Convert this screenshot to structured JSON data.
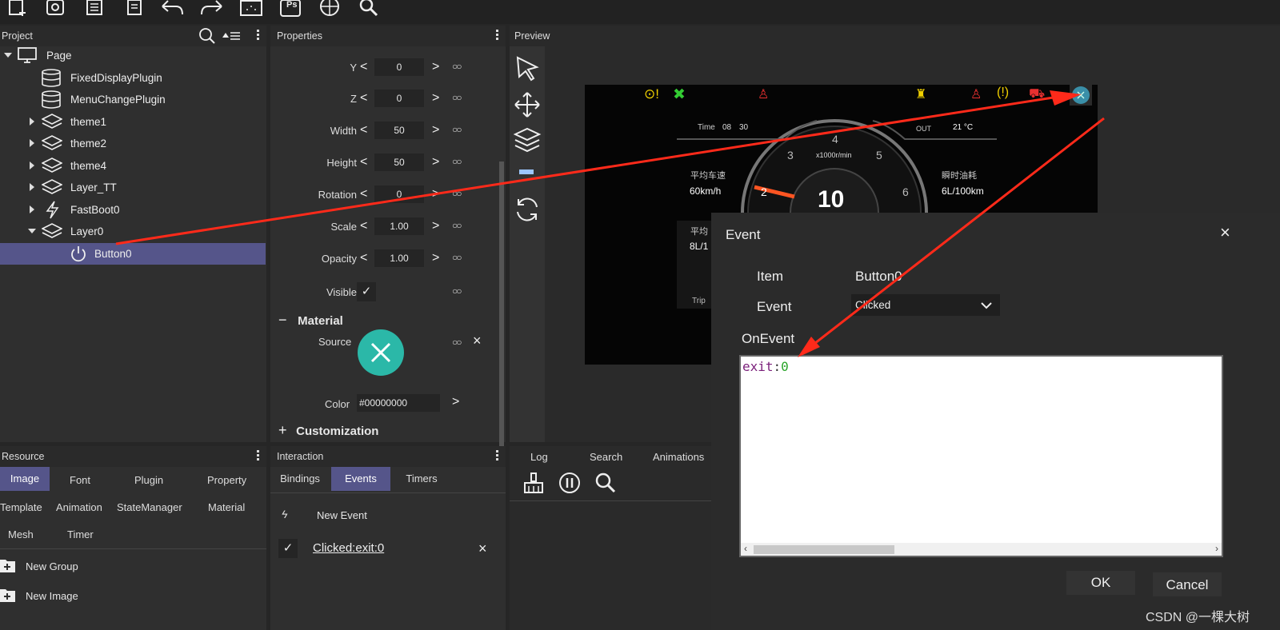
{
  "toolbar": {
    "icons": [
      "new-file-icon",
      "camera-icon",
      "copy-icon",
      "paste-icon",
      "undo-icon",
      "redo-icon",
      "grid-icon",
      "photoshop-icon",
      "globe-icon",
      "search-icon"
    ],
    "ps_label": "Ps"
  },
  "project": {
    "title": "Project",
    "items": [
      {
        "label": "Page"
      },
      {
        "label": "FixedDisplayPlugin"
      },
      {
        "label": "MenuChangePlugin"
      },
      {
        "label": "theme1"
      },
      {
        "label": "theme2"
      },
      {
        "label": "theme4"
      },
      {
        "label": "Layer_TT"
      },
      {
        "label": "FastBoot0"
      },
      {
        "label": "Layer0"
      },
      {
        "label": "Button0"
      }
    ]
  },
  "properties": {
    "title": "Properties",
    "rows": [
      {
        "label": "Y",
        "value": "0"
      },
      {
        "label": "Z",
        "value": "0"
      },
      {
        "label": "Width",
        "value": "50"
      },
      {
        "label": "Height",
        "value": "50"
      },
      {
        "label": "Rotation",
        "value": "0"
      },
      {
        "label": "Scale",
        "value": "1.00"
      },
      {
        "label": "Opacity",
        "value": "1.00"
      }
    ],
    "visible_label": "Visible",
    "material_label": "Material",
    "source_label": "Source",
    "color_label": "Color",
    "color_value": "#00000000",
    "customization_label": "Customization",
    "source_color": "#2bb8a8"
  },
  "preview": {
    "title": "Preview",
    "dash": {
      "time_label": "Time",
      "time_h": "08",
      "time_m": "30",
      "out_label": "OUT",
      "out_value": "21 °C",
      "rpm_label": "x1000r/min",
      "speed_label": "平均车速",
      "speed_value": "60km/h",
      "fuel_label": "瞬时油耗",
      "fuel_value": "6L/100km",
      "avg_label": "平均",
      "avg_value": "8L/1",
      "trip_label": "Trip",
      "big_number": "10",
      "ticks": [
        "2",
        "3",
        "4",
        "5",
        "6"
      ]
    }
  },
  "resource": {
    "title": "Resource",
    "tabs": [
      "Image",
      "Font",
      "Plugin",
      "Property",
      "Template",
      "Animation",
      "StateManager",
      "Material",
      "Mesh",
      "Timer"
    ],
    "actions": [
      "New Group",
      "New Image"
    ]
  },
  "interaction": {
    "title": "Interaction",
    "tabs": [
      "Bindings",
      "Events",
      "Timers"
    ],
    "new_event": "New Event",
    "event_item": "Clicked:exit:0"
  },
  "log": {
    "tabs": [
      "Log",
      "Search",
      "Animations"
    ]
  },
  "dialog": {
    "title": "Event",
    "item_label": "Item",
    "item_value": "Button0",
    "event_label": "Event",
    "event_value": "Clicked",
    "onevent_label": "OnEvent",
    "code_keyword": "exit",
    "code_sep": ":",
    "code_value": "0",
    "ok_label": "OK",
    "cancel_label": "Cancel"
  },
  "watermark": "CSDN @一棵大树"
}
